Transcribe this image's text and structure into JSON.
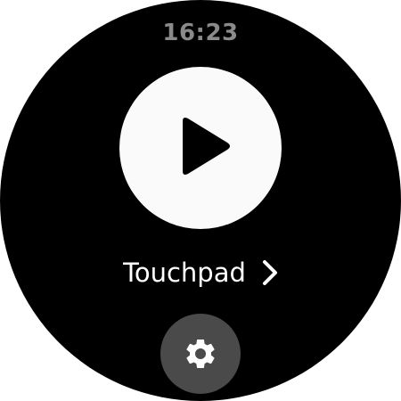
{
  "status_bar": {
    "time": "16:23"
  },
  "main": {
    "play_icon": "play-icon",
    "touchpad_label": "Touchpad",
    "touchpad_chevron_icon": "chevron-right-icon"
  },
  "footer": {
    "settings_icon": "gear-icon"
  },
  "colors": {
    "face_background": "#000000",
    "time_text": "#8a8a8a",
    "play_button_fill": "#fafafa",
    "play_glyph": "#000000",
    "label_text": "#ffffff",
    "settings_button_fill": "#4a4a4a",
    "settings_glyph": "#ffffff"
  }
}
